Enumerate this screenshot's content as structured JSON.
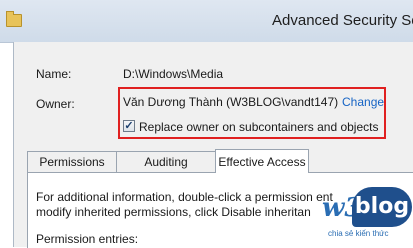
{
  "window": {
    "title": "Advanced Security Se"
  },
  "fields": {
    "name_label": "Name:",
    "name_value": "D:\\Windows\\Media",
    "owner_label": "Owner:",
    "owner_value": "Văn Dương Thành (W3BLOG\\vandt147)",
    "change_link": "Change",
    "replace_owner_label": "Replace owner on subcontainers and objects",
    "replace_owner_checked": true
  },
  "tabs": [
    {
      "label": "Permissions",
      "active": false
    },
    {
      "label": "Auditing",
      "active": false
    },
    {
      "label": "Effective Access",
      "active": true
    }
  ],
  "panel": {
    "info_line1": "For additional information, double-click a permission ent",
    "info_line2": "modify inherited permissions, click Disable inheritan",
    "entries_label": "Permission entries:"
  },
  "watermark": {
    "w3": "w3",
    "blog": "blog",
    "slogan": "chia sẻ kiến thức"
  },
  "colors": {
    "highlight_box": "#e02020",
    "link": "#1664c5"
  }
}
